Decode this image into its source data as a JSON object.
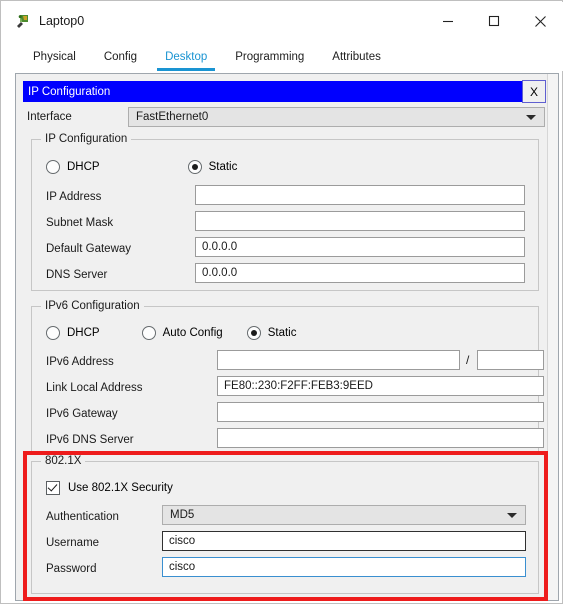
{
  "window": {
    "title": "Laptop0",
    "icon": "packet-tracer-laptop-icon",
    "minimize_label": "─",
    "maximize_label": "□",
    "close_label": "✕"
  },
  "tabs": [
    {
      "label": "Physical",
      "active": false
    },
    {
      "label": "Config",
      "active": false
    },
    {
      "label": "Desktop",
      "active": true
    },
    {
      "label": "Programming",
      "active": false
    },
    {
      "label": "Attributes",
      "active": false
    }
  ],
  "dialog": {
    "title": "IP Configuration",
    "close_label": "X",
    "title_bg": "#0000FF",
    "title_fg": "#FFFFFF"
  },
  "interface": {
    "label": "Interface",
    "value": "FastEthernet0"
  },
  "ipv4": {
    "group_title": "IP Configuration",
    "modes": [
      {
        "label": "DHCP",
        "selected": false
      },
      {
        "label": "Static",
        "selected": true
      }
    ],
    "fields": [
      {
        "label": "IP Address",
        "value": "",
        "focused": false
      },
      {
        "label": "Subnet Mask",
        "value": "",
        "focused": false
      },
      {
        "label": "Default Gateway",
        "value": "0.0.0.0",
        "focused": false
      },
      {
        "label": "DNS Server",
        "value": "0.0.0.0",
        "focused": false
      }
    ]
  },
  "ipv6": {
    "group_title": "IPv6 Configuration",
    "modes": [
      {
        "label": "DHCP",
        "selected": false
      },
      {
        "label": "Auto Config",
        "selected": false
      },
      {
        "label": "Static",
        "selected": true
      }
    ],
    "address_label": "IPv6 Address",
    "address_value": "",
    "prefix_separator": "/",
    "prefix_value": "",
    "fields": [
      {
        "label": "Link Local Address",
        "value": "FE80::230:F2FF:FEB3:9EED"
      },
      {
        "label": "IPv6 Gateway",
        "value": ""
      },
      {
        "label": "IPv6 DNS Server",
        "value": ""
      }
    ]
  },
  "dot1x": {
    "group_title": "802.1X",
    "use_security": {
      "label": "Use 802.1X Security",
      "checked": true
    },
    "authentication": {
      "label": "Authentication",
      "value": "MD5"
    },
    "username": {
      "label": "Username",
      "value": "cisco",
      "focused": false
    },
    "password": {
      "label": "Password",
      "value": "cisco",
      "focused": true
    },
    "highlight_color": "#EE1C1C"
  }
}
